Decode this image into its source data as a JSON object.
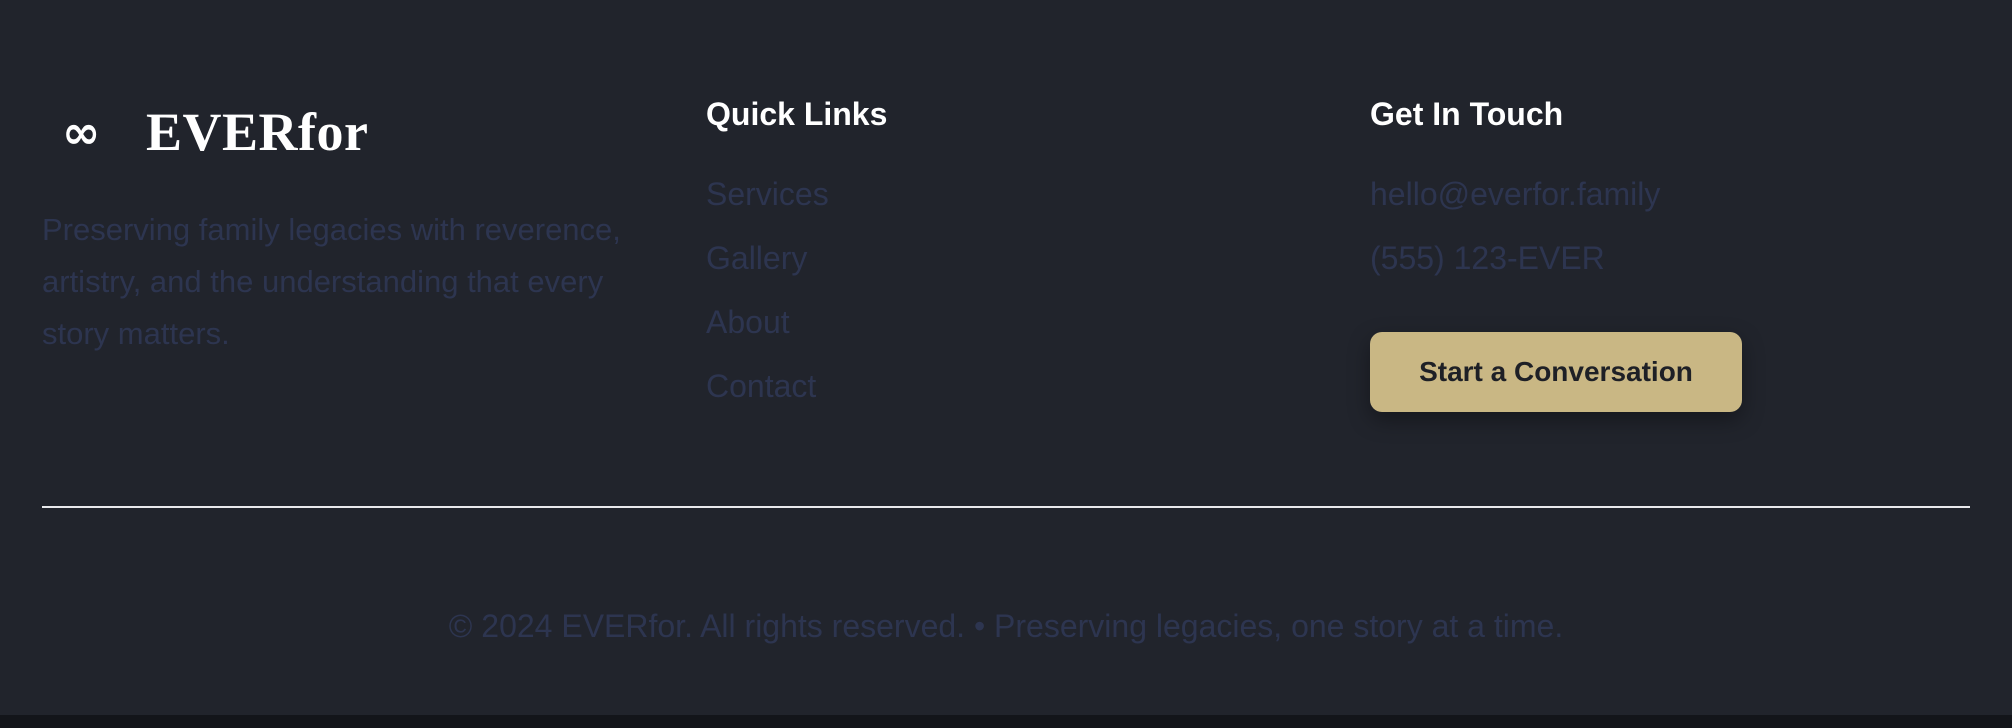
{
  "brand": {
    "icon": "infinity-icon",
    "icon_glyph": "∞",
    "name": "EVERfor",
    "tagline": "Preserving family legacies with reverence, artistry, and the understanding that every story matters."
  },
  "quick_links": {
    "title": "Quick Links",
    "items": [
      {
        "label": "Services"
      },
      {
        "label": "Gallery"
      },
      {
        "label": "About"
      },
      {
        "label": "Contact"
      }
    ]
  },
  "contact": {
    "title": "Get In Touch",
    "email": "hello@everfor.family",
    "phone": "(555) 123-EVER",
    "cta_label": "Start a Conversation"
  },
  "footer": {
    "copyright": "© 2024 EVERfor. All rights reserved. • Preserving legacies, one story at a time."
  },
  "colors": {
    "background": "#21242c",
    "accent": "#c9b784",
    "muted_text": "#2d3550",
    "heading_text": "#ffffff"
  }
}
